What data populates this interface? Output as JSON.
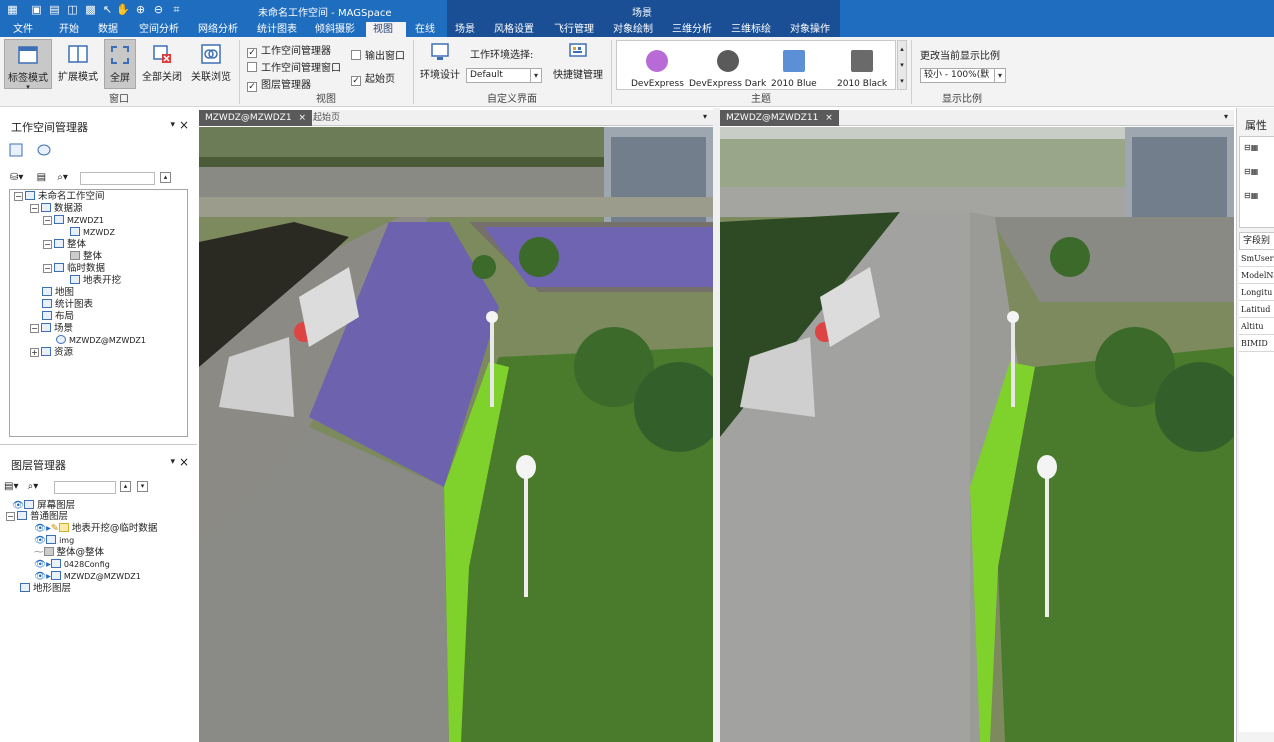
{
  "window": {
    "title": "未命名工作空间 - MAGSpace",
    "context_tab_title": "场景"
  },
  "menu": {
    "items": [
      "文件",
      "开始",
      "数据",
      "空间分析",
      "网络分析",
      "统计图表",
      "倾斜摄影",
      "视图",
      "在线",
      "场景",
      "风格设置",
      "飞行管理",
      "对象绘制",
      "三维分析",
      "三维标绘",
      "对象操作"
    ],
    "active": "视图"
  },
  "ribbon": {
    "window_group": {
      "label": "窗口",
      "buttons": [
        "标签模式",
        "扩展模式",
        "全屏",
        "全部关闭",
        "关联浏览"
      ]
    },
    "view_group": {
      "label": "视图",
      "checks": [
        {
          "label": "工作空间管理器",
          "checked": true
        },
        {
          "label": "工作空间管理窗口",
          "checked": false
        },
        {
          "label": "图层管理器",
          "checked": true
        },
        {
          "label": "输出窗口",
          "checked": false
        },
        {
          "label": "起始页",
          "checked": true
        }
      ]
    },
    "custom_group": {
      "label": "自定义界面",
      "env_design": "环境设计",
      "env_select_label": "工作环境选择:",
      "env_select_value": "Default",
      "shortcut": "快捷键管理"
    },
    "theme_group": {
      "label": "主题",
      "themes": [
        {
          "name": "DevExpress",
          "color": "#b86bd6"
        },
        {
          "name": "DevExpress Dark",
          "color": "#5a5a5a"
        },
        {
          "name": "2010 Blue",
          "color": "#5c8fd6"
        },
        {
          "name": "2010 Black",
          "color": "#6a6a6a"
        }
      ]
    },
    "scale_group": {
      "label": "显示比例",
      "caption": "更改当前显示比例",
      "value": "较小 - 100%(默"
    }
  },
  "workspace_panel": {
    "title": "工作空间管理器",
    "nodes": [
      {
        "label": "未命名工作空间",
        "level": 0,
        "exp": "-"
      },
      {
        "label": "数据源",
        "level": 1,
        "exp": "-"
      },
      {
        "label": "MZWDZ1",
        "level": 2,
        "exp": "-"
      },
      {
        "label": "MZWDZ",
        "level": 3,
        "exp": ""
      },
      {
        "label": "整体",
        "level": 2,
        "exp": "-"
      },
      {
        "label": "整体",
        "level": 3,
        "exp": ""
      },
      {
        "label": "临时数据",
        "level": 2,
        "exp": "-"
      },
      {
        "label": "地表开挖",
        "level": 3,
        "exp": ""
      },
      {
        "label": "地图",
        "level": 1,
        "exp": ""
      },
      {
        "label": "统计图表",
        "level": 1,
        "exp": ""
      },
      {
        "label": "布局",
        "level": 1,
        "exp": ""
      },
      {
        "label": "场景",
        "level": 1,
        "exp": "-"
      },
      {
        "label": "MZWDZ@MZWDZ1",
        "level": 2,
        "exp": ""
      },
      {
        "label": "资源",
        "level": 1,
        "exp": "+"
      }
    ]
  },
  "layer_panel": {
    "title": "图层管理器",
    "nodes": [
      {
        "label": "屏幕图层",
        "level": 1
      },
      {
        "label": "普通图层",
        "level": 0
      },
      {
        "label": "地表开挖@临时数据",
        "level": 2
      },
      {
        "label": "img",
        "level": 2
      },
      {
        "label": "整体@整体",
        "level": 2
      },
      {
        "label": "0428Config",
        "level": 2
      },
      {
        "label": "MZWDZ@MZWDZ1",
        "level": 2
      },
      {
        "label": "地形图层",
        "level": 1
      }
    ]
  },
  "scene_left": {
    "tabs": [
      "MZWDZ@MZWDZ1",
      "起始页"
    ]
  },
  "scene_right": {
    "tabs": [
      "MZWDZ@MZWDZ11"
    ]
  },
  "props_panel": {
    "title": "属性",
    "field_header": "字段别",
    "fields": [
      "SmUserI",
      "ModelNa",
      "Longitu",
      "Latitud",
      "Altitu",
      "BIMID"
    ]
  }
}
